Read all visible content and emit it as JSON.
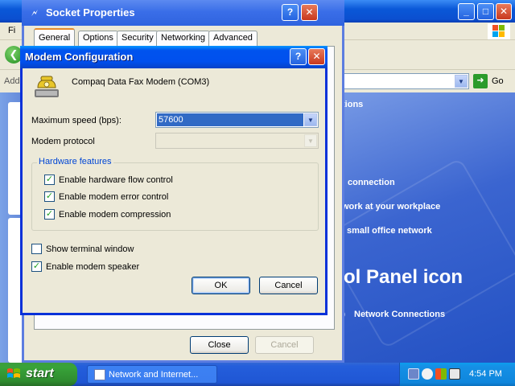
{
  "explorer": {
    "menu_file": "Fi",
    "address_label": "Add",
    "go_label": "Go",
    "content": {
      "line1": "tions",
      "line2": "connection",
      "line3": "work at your workplace",
      "line4": "small office network",
      "heading": "ol Panel icon",
      "network_connections": "Network Connections"
    }
  },
  "socket": {
    "title": "Socket Properties",
    "tabs": [
      "General",
      "Options",
      "Security",
      "Networking",
      "Advanced"
    ],
    "active_tab": "General",
    "close_label": "Close",
    "cancel_label": "Cancel"
  },
  "modem": {
    "title": "Modem Configuration",
    "modem_name": "Compaq Data Fax Modem (COM3)",
    "max_speed_label": "Maximum speed (bps):",
    "max_speed_value": "57600",
    "protocol_label": "Modem protocol",
    "protocol_value": "",
    "hardware_group": "Hardware features",
    "checkboxes": [
      {
        "label": "Enable hardware flow control",
        "checked": true
      },
      {
        "label": "Enable modem error control",
        "checked": true
      },
      {
        "label": "Enable modem compression",
        "checked": true
      },
      {
        "label": "Show terminal window",
        "checked": false
      },
      {
        "label": "Enable modem speaker",
        "checked": true
      }
    ],
    "ok_label": "OK",
    "cancel_label": "Cancel",
    "help_glyph": "?",
    "close_glyph": "✕"
  },
  "taskbar": {
    "start_label": "start",
    "task_label": "Network and Internet...",
    "clock": "4:54 PM"
  },
  "colors": {
    "xp_blue": "#0053ee",
    "start_green": "#38a339",
    "selection": "#316ac5",
    "groupbox_text": "#0046d5"
  },
  "icons": [
    "back-arrow-icon",
    "go-arrow-icon",
    "windows-logo-icon",
    "phone-modem-icon",
    "network-connections-icon",
    "windows-flag-icon",
    "task-window-icon",
    "tray-icons"
  ]
}
